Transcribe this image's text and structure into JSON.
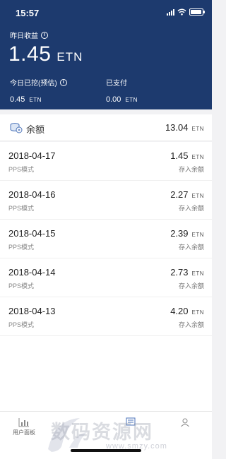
{
  "status_bar": {
    "time": "15:57"
  },
  "header": {
    "yesterday_label": "昨日收益",
    "yesterday_value": "1.45",
    "unit": "ETN",
    "today_label": "今日已挖(预估)",
    "today_value": "0.45",
    "paid_label": "已支付",
    "paid_value": "0.00"
  },
  "balance": {
    "label": "余额",
    "value": "13.04",
    "unit": "ETN"
  },
  "records": [
    {
      "date": "2018-04-17",
      "mode": "PPS模式",
      "amount": "1.45",
      "unit": "ETN",
      "note": "存入余额"
    },
    {
      "date": "2018-04-16",
      "mode": "PPS模式",
      "amount": "2.27",
      "unit": "ETN",
      "note": "存入余额"
    },
    {
      "date": "2018-04-15",
      "mode": "PPS模式",
      "amount": "2.39",
      "unit": "ETN",
      "note": "存入余额"
    },
    {
      "date": "2018-04-14",
      "mode": "PPS模式",
      "amount": "2.73",
      "unit": "ETN",
      "note": "存入余额"
    },
    {
      "date": "2018-04-13",
      "mode": "PPS模式",
      "amount": "4.20",
      "unit": "ETN",
      "note": "存入余额"
    }
  ],
  "tabbar": {
    "dashboard_label": "用户面板"
  },
  "watermark": {
    "text": "数码资源网",
    "url": "www.smzy.com"
  },
  "colors": {
    "header_bg": "#1d3a6e",
    "page_bg": "#f2f2f4"
  }
}
